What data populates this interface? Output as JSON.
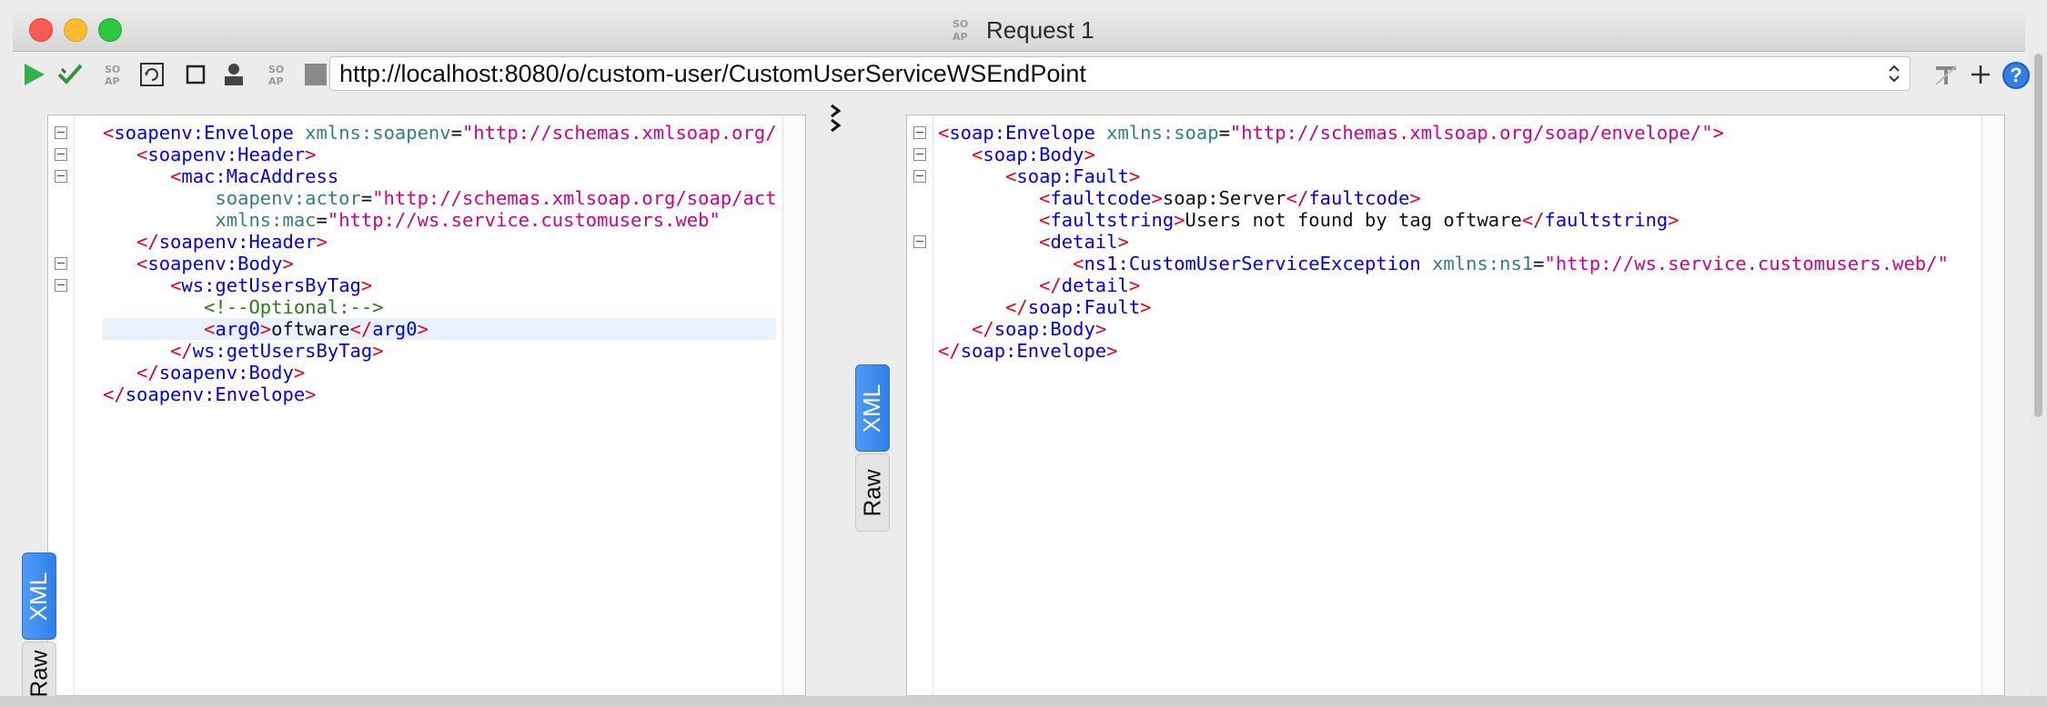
{
  "window": {
    "title": "Request 1",
    "logo_text": "SO AP"
  },
  "toolbar": {
    "url": "http://localhost:8080/o/custom-user/CustomUserServiceWSEndPoint",
    "help_label": "?"
  },
  "request_panel": {
    "tabs": [
      {
        "label": "XML",
        "active": true
      },
      {
        "label": "Raw",
        "active": false
      }
    ],
    "lines": [
      [
        {
          "c": "br",
          "t": "<"
        },
        {
          "c": "tag",
          "t": "soapenv:Envelope"
        },
        {
          "c": "",
          "t": " "
        },
        {
          "c": "attr",
          "t": "xmlns:soapenv"
        },
        {
          "c": "",
          "t": "="
        },
        {
          "c": "val",
          "t": "\"http://schemas.xmlsoap.org/soap/envelope/\""
        }
      ],
      [
        {
          "c": "",
          "t": "   "
        },
        {
          "c": "br",
          "t": "<"
        },
        {
          "c": "tag",
          "t": "soapenv:Header"
        },
        {
          "c": "br",
          "t": ">"
        }
      ],
      [
        {
          "c": "",
          "t": "      "
        },
        {
          "c": "br",
          "t": "<"
        },
        {
          "c": "tag",
          "t": "mac:MacAddress"
        }
      ],
      [
        {
          "c": "",
          "t": "          "
        },
        {
          "c": "attr",
          "t": "soapenv:actor"
        },
        {
          "c": "",
          "t": "="
        },
        {
          "c": "val",
          "t": "\"http://schemas.xmlsoap.org/soap/actor/next\""
        }
      ],
      [
        {
          "c": "",
          "t": "          "
        },
        {
          "c": "attr",
          "t": "xmlns:mac"
        },
        {
          "c": "",
          "t": "="
        },
        {
          "c": "val",
          "t": "\"http://ws.service.customusers.web\""
        }
      ],
      [
        {
          "c": "",
          "t": "   "
        },
        {
          "c": "br",
          "t": "</"
        },
        {
          "c": "tag",
          "t": "soapenv:Header"
        },
        {
          "c": "br",
          "t": ">"
        }
      ],
      [
        {
          "c": "",
          "t": "   "
        },
        {
          "c": "br",
          "t": "<"
        },
        {
          "c": "tag",
          "t": "soapenv:Body"
        },
        {
          "c": "br",
          "t": ">"
        }
      ],
      [
        {
          "c": "",
          "t": "      "
        },
        {
          "c": "br",
          "t": "<"
        },
        {
          "c": "tag",
          "t": "ws:getUsersByTag"
        },
        {
          "c": "br",
          "t": ">"
        }
      ],
      [
        {
          "c": "",
          "t": "         "
        },
        {
          "c": "cmt",
          "t": "<!--Optional:-->"
        }
      ],
      [
        {
          "c": "",
          "t": "         "
        },
        {
          "c": "br",
          "t": "<"
        },
        {
          "c": "tag",
          "t": "arg0"
        },
        {
          "c": "br",
          "t": ">"
        },
        {
          "c": "",
          "t": "oftware"
        },
        {
          "c": "br",
          "t": "</"
        },
        {
          "c": "tag",
          "t": "arg0"
        },
        {
          "c": "br",
          "t": ">"
        }
      ],
      [
        {
          "c": "",
          "t": "      "
        },
        {
          "c": "br",
          "t": "</"
        },
        {
          "c": "tag",
          "t": "ws:getUsersByTag"
        },
        {
          "c": "br",
          "t": ">"
        }
      ],
      [
        {
          "c": "",
          "t": "   "
        },
        {
          "c": "br",
          "t": "</"
        },
        {
          "c": "tag",
          "t": "soapenv:Body"
        },
        {
          "c": "br",
          "t": ">"
        }
      ],
      [
        {
          "c": "br",
          "t": "</"
        },
        {
          "c": "tag",
          "t": "soapenv:Envelope"
        },
        {
          "c": "br",
          "t": ">"
        }
      ]
    ]
  },
  "response_panel": {
    "tabs": [
      {
        "label": "XML",
        "active": true
      },
      {
        "label": "Raw",
        "active": false
      }
    ],
    "lines": [
      [
        {
          "c": "br",
          "t": "<"
        },
        {
          "c": "tag",
          "t": "soap:Envelope"
        },
        {
          "c": "",
          "t": " "
        },
        {
          "c": "attr",
          "t": "xmlns:soap"
        },
        {
          "c": "",
          "t": "="
        },
        {
          "c": "val",
          "t": "\"http://schemas.xmlsoap.org/soap/envelope/\""
        },
        {
          "c": "br",
          "t": ">"
        }
      ],
      [
        {
          "c": "",
          "t": "   "
        },
        {
          "c": "br",
          "t": "<"
        },
        {
          "c": "tag",
          "t": "soap:Body"
        },
        {
          "c": "br",
          "t": ">"
        }
      ],
      [
        {
          "c": "",
          "t": "      "
        },
        {
          "c": "br",
          "t": "<"
        },
        {
          "c": "tag",
          "t": "soap:Fault"
        },
        {
          "c": "br",
          "t": ">"
        }
      ],
      [
        {
          "c": "",
          "t": "         "
        },
        {
          "c": "br",
          "t": "<"
        },
        {
          "c": "tag",
          "t": "faultcode"
        },
        {
          "c": "br",
          "t": ">"
        },
        {
          "c": "",
          "t": "soap:Server"
        },
        {
          "c": "br",
          "t": "</"
        },
        {
          "c": "tag",
          "t": "faultcode"
        },
        {
          "c": "br",
          "t": ">"
        }
      ],
      [
        {
          "c": "",
          "t": "         "
        },
        {
          "c": "br",
          "t": "<"
        },
        {
          "c": "tag",
          "t": "faultstring"
        },
        {
          "c": "br",
          "t": ">"
        },
        {
          "c": "",
          "t": "Users not found by tag oftware"
        },
        {
          "c": "br",
          "t": "</"
        },
        {
          "c": "tag",
          "t": "faultstring"
        },
        {
          "c": "br",
          "t": ">"
        }
      ],
      [
        {
          "c": "",
          "t": "         "
        },
        {
          "c": "br",
          "t": "<"
        },
        {
          "c": "tag",
          "t": "detail"
        },
        {
          "c": "br",
          "t": ">"
        }
      ],
      [
        {
          "c": "",
          "t": "            "
        },
        {
          "c": "br",
          "t": "<"
        },
        {
          "c": "tag",
          "t": "ns1:CustomUserServiceException"
        },
        {
          "c": "",
          "t": " "
        },
        {
          "c": "attr",
          "t": "xmlns:ns1"
        },
        {
          "c": "",
          "t": "="
        },
        {
          "c": "val",
          "t": "\"http://ws.service.customusers.web/\""
        }
      ],
      [
        {
          "c": "",
          "t": "         "
        },
        {
          "c": "br",
          "t": "</"
        },
        {
          "c": "tag",
          "t": "detail"
        },
        {
          "c": "br",
          "t": ">"
        }
      ],
      [
        {
          "c": "",
          "t": "      "
        },
        {
          "c": "br",
          "t": "</"
        },
        {
          "c": "tag",
          "t": "soap:Fault"
        },
        {
          "c": "br",
          "t": ">"
        }
      ],
      [
        {
          "c": "",
          "t": "   "
        },
        {
          "c": "br",
          "t": "</"
        },
        {
          "c": "tag",
          "t": "soap:Body"
        },
        {
          "c": "br",
          "t": ">"
        }
      ],
      [
        {
          "c": "br",
          "t": "</"
        },
        {
          "c": "tag",
          "t": "soap:Envelope"
        },
        {
          "c": "br",
          "t": ">"
        }
      ]
    ]
  },
  "colors": {
    "tag": "#0000e6",
    "bracket": "#e6001e",
    "attribute": "#2f7f7f",
    "value": "#d0008a",
    "comment": "#2a7a20",
    "active_tab": "#3a88f0"
  }
}
